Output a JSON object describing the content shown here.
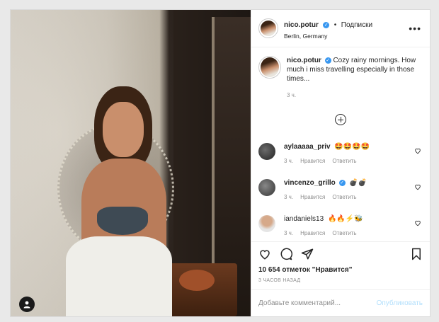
{
  "post": {
    "author": {
      "username": "nico.potur",
      "follow_label": "Подписки",
      "location": "Berlin, Germany"
    },
    "caption": {
      "username": "nico.potur",
      "text": "Cozy rainy mornings. How much i miss travelling especially in those times...",
      "time": "3 ч."
    },
    "comments": [
      {
        "username": "aylaaaaa_priv",
        "text": "🤩🤩🤩🤩",
        "time": "3 ч.",
        "like_label": "Нравится",
        "reply_label": "Ответить",
        "verified": false
      },
      {
        "username": "vincenzo_grillo",
        "text": "💣💣",
        "time": "3 ч.",
        "like_label": "Нравится",
        "reply_label": "Ответить",
        "verified": true
      },
      {
        "username": "iandaniels13",
        "text": "🔥🔥⚡🐝",
        "time": "3 ч.",
        "like_label": "Нравится",
        "reply_label": "Ответить",
        "verified": false
      }
    ],
    "likes_text": "10 654 отметок \"Нравится\"",
    "posted_ago": "3 ЧАСОВ НАЗАД",
    "comment_input": {
      "placeholder": "Добавьте комментарий...",
      "value": ""
    },
    "publish_label": "Опубликовать",
    "colors": {
      "verified": "#3897f0",
      "publish": "#b2dffc",
      "muted": "#8e8e8e"
    },
    "icons": [
      "user-tag-icon",
      "more-icon",
      "add-circle-icon",
      "heart-icon",
      "comment-icon",
      "share-icon",
      "bookmark-icon",
      "verified-icon"
    ]
  }
}
